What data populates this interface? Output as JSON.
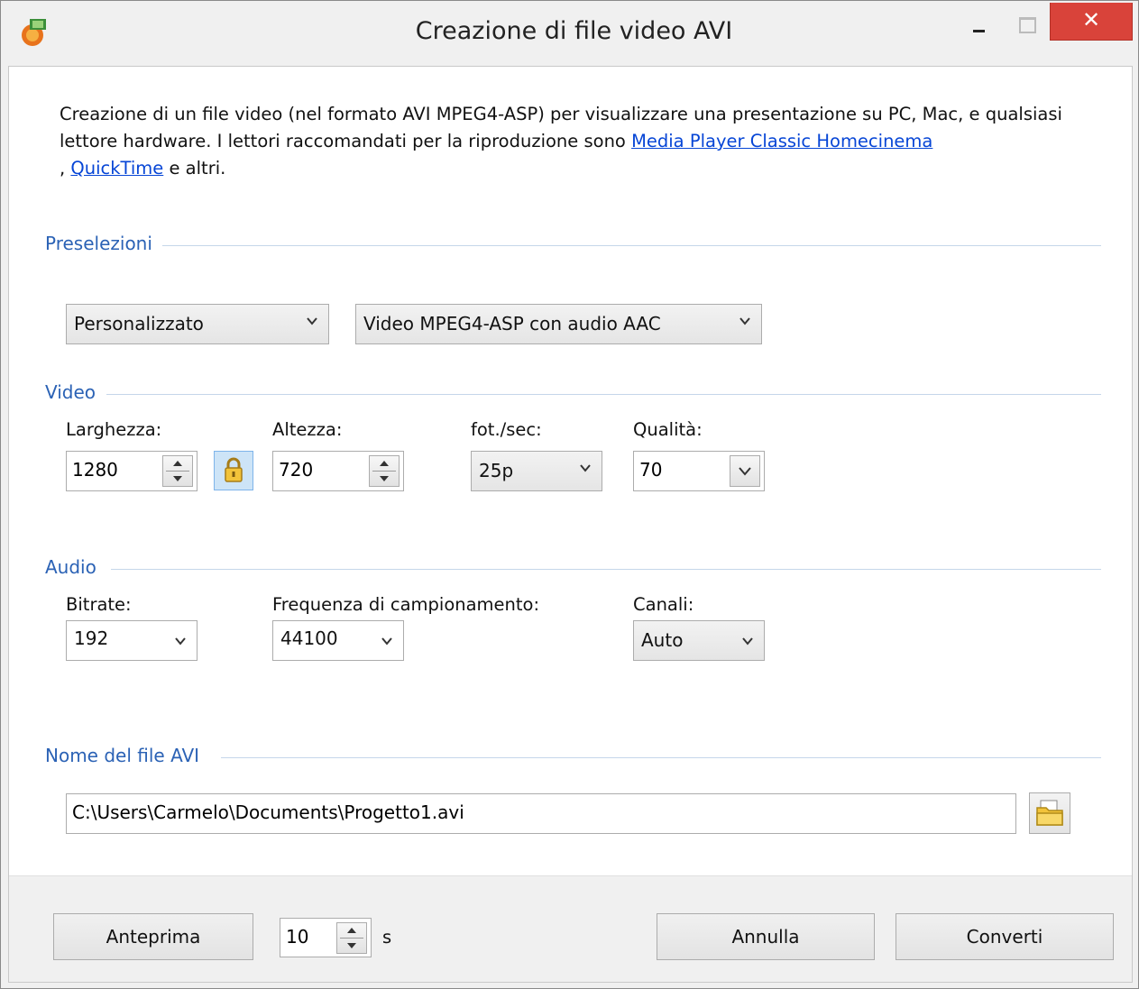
{
  "window": {
    "title": "Creazione di file video AVI",
    "close_glyph": "✕"
  },
  "intro": {
    "text_before": "Creazione di un file video (nel formato AVI MPEG4-ASP) per visualizzare una presentazione su PC, Mac, e qualsiasi lettore hardware. I lettori raccomandati per la riproduzione sono ",
    "link1": "Media Player Classic Homecinema ",
    "sep": ", ",
    "link2": "QuickTime",
    "text_after": " e altri."
  },
  "presets": {
    "section_title": "Preselezioni",
    "preset_value": "Personalizzato",
    "format_value": "Video MPEG4-ASP con audio AAC"
  },
  "video": {
    "section_title": "Video",
    "width_label": "Larghezza:",
    "width_value": "1280",
    "height_label": "Altezza:",
    "height_value": "720",
    "fps_label": "fot./sec:",
    "fps_value": "25p",
    "quality_label": "Qualità:",
    "quality_value": "70"
  },
  "audio": {
    "section_title": "Audio",
    "bitrate_label": "Bitrate:",
    "bitrate_value": "192",
    "samplerate_label": "Frequenza di campionamento:",
    "samplerate_value": "44100",
    "channels_label": "Canali:",
    "channels_value": "Auto"
  },
  "file": {
    "section_title": "Nome del file AVI",
    "path": "C:\\Users\\Carmelo\\Documents\\Progetto1.avi"
  },
  "footer": {
    "preview_label": "Anteprima",
    "preview_seconds": "10",
    "seconds_unit": "s",
    "cancel_label": "Annulla",
    "convert_label": "Converti"
  },
  "colors": {
    "section_title": "#2b62b5",
    "link": "#0645d6",
    "close_button": "#d9433a"
  }
}
